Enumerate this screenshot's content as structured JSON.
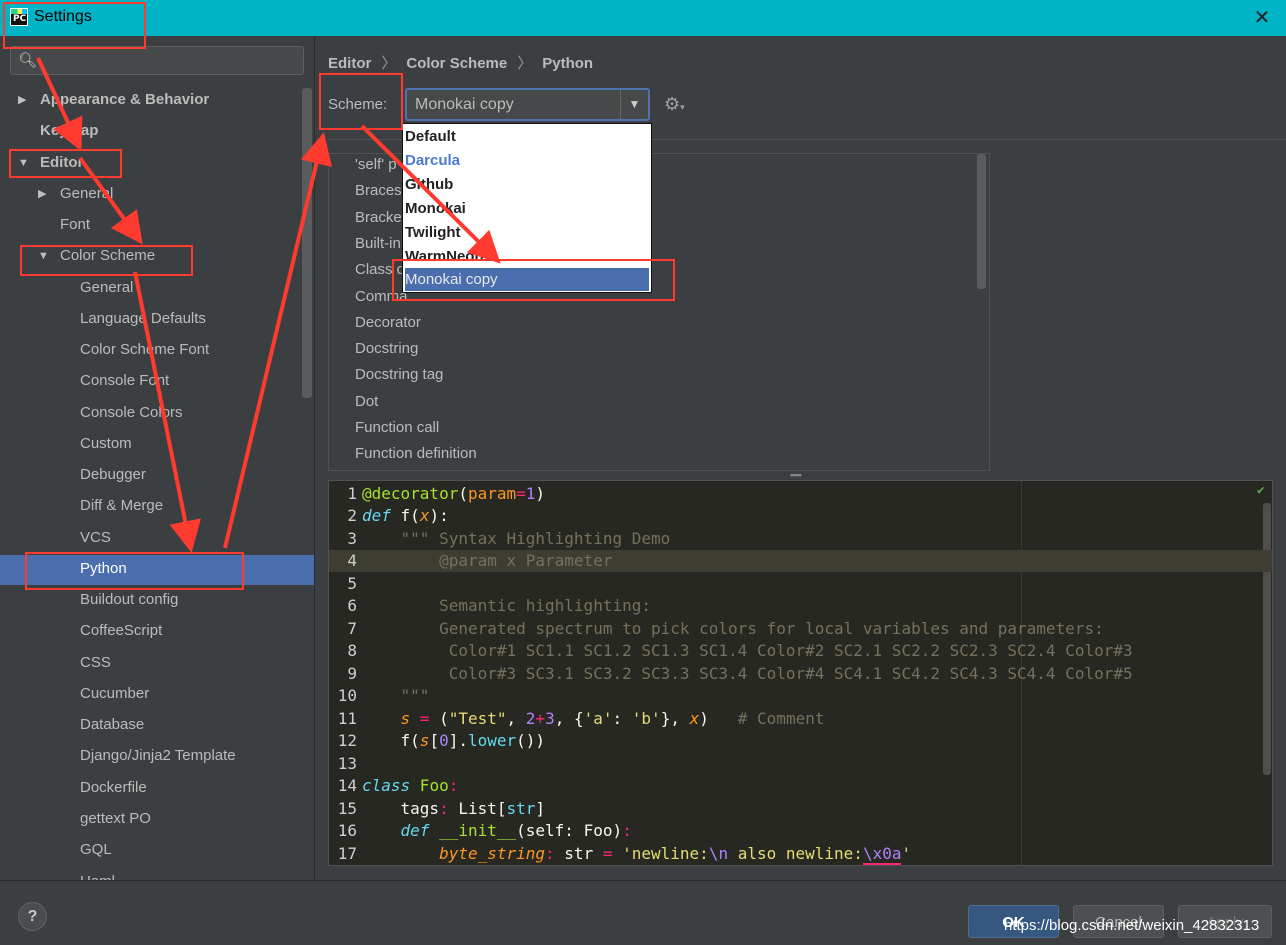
{
  "window": {
    "title": "Settings",
    "close_label": "✕",
    "logo_text": "PC"
  },
  "sidebar": {
    "search_placeholder": "",
    "items": [
      {
        "label": "Appearance & Behavior",
        "arrow": "▶"
      },
      {
        "label": "Keymap"
      },
      {
        "label": "Editor",
        "arrow": "▼"
      },
      {
        "label": "General",
        "arrow": "▶"
      },
      {
        "label": "Font"
      },
      {
        "label": "Color Scheme",
        "arrow": "▼"
      },
      {
        "label": "General"
      },
      {
        "label": "Language Defaults"
      },
      {
        "label": "Color Scheme Font"
      },
      {
        "label": "Console Font"
      },
      {
        "label": "Console Colors"
      },
      {
        "label": "Custom"
      },
      {
        "label": "Debugger"
      },
      {
        "label": "Diff & Merge"
      },
      {
        "label": "VCS"
      },
      {
        "label": "Python"
      },
      {
        "label": "Buildout config"
      },
      {
        "label": "CoffeeScript"
      },
      {
        "label": "CSS"
      },
      {
        "label": "Cucumber"
      },
      {
        "label": "Database"
      },
      {
        "label": "Django/Jinja2 Template"
      },
      {
        "label": "Dockerfile"
      },
      {
        "label": "gettext PO"
      },
      {
        "label": "GQL"
      },
      {
        "label": "Haml"
      }
    ]
  },
  "breadcrumb": [
    "Editor",
    "Color Scheme",
    "Python"
  ],
  "breadcrumb_sep": "〉",
  "scheme": {
    "label": "Scheme:",
    "value": "Monokai copy",
    "options": [
      "Default",
      "Darcula",
      "Github",
      "Monokai",
      "Twilight",
      "WarmNeon",
      "Monokai copy"
    ]
  },
  "elements": [
    "'self' p",
    "Braces",
    "Bracke",
    "Built-in",
    "Class d",
    "Comma",
    "Decorator",
    "Docstring",
    "Docstring tag",
    "Dot",
    "Function call",
    "Function definition"
  ],
  "editor": {
    "line_numbers": [
      "1",
      "2",
      "3",
      "4",
      "5",
      "6",
      "7",
      "8",
      "9",
      "10",
      "11",
      "12",
      "13",
      "14",
      "15",
      "16",
      "17"
    ],
    "current_line": 4,
    "texts": {
      "l1_deco": "@decorator",
      "l1_paren": "(",
      "l1_param": "param",
      "l1_eq": "=",
      "l1_num": "1",
      "l1_close": ")",
      "l2_def": "def",
      "l2_name": " f(",
      "l2_x": "x",
      "l2_end": "):",
      "l3": "    \"\"\" Syntax Highlighting Demo",
      "l4": "        @param x Parameter",
      "l6": "        Semantic highlighting:",
      "l7": "        Generated spectrum to pick colors for local variables and parameters:",
      "l8": "         Color#1 SC1.1 SC1.2 SC1.3 SC1.4 Color#2 SC2.1 SC2.2 SC2.3 SC2.4 Color#3",
      "l9": "         Color#3 SC3.1 SC3.2 SC3.3 SC3.4 Color#4 SC4.1 SC4.2 SC4.3 SC4.4 Color#5",
      "l10": "    \"\"\"",
      "l11_s": "s",
      "l11_eq": " = ",
      "l11_open": "(",
      "l11_str": "\"Test\"",
      "l11_c1": ", ",
      "l11_n1": "2",
      "l11_plus": "+",
      "l11_n2": "3",
      "l11_c2": ", {",
      "l11_a": "'a'",
      "l11_colon": ": ",
      "l11_b": "'b'",
      "l11_c3": "}, ",
      "l11_x": "x",
      "l11_close": ")",
      "l11_cmt": "   # Comment",
      "l12_f": "    f(",
      "l12_s": "s",
      "l12_idx": "[",
      "l12_zero": "0",
      "l12_rest": "].",
      "l12_lower": "lower",
      "l12_end": "())",
      "l14_class": "class",
      "l14_name": " Foo",
      "l14_colon": ":",
      "l15_tags": "    tags",
      "l15_colon": ": ",
      "l15_list": "List",
      "l15_br": "[",
      "l15_str": "str",
      "l15_end": "]",
      "l16_def": "    def",
      "l16_init": " __init__",
      "l16_rest": "(self: Foo)",
      "l16_colon": ":",
      "l17_var": "        byte_string",
      "l17_colon": ": ",
      "l17_type": "str",
      "l17_eq": " = ",
      "l17_str1": "'newline:",
      "l17_esc1": "\\n",
      "l17_str2": " also newline:",
      "l17_esc2": "\\x0a",
      "l17_str3": "'"
    }
  },
  "buttons": {
    "help": "?",
    "ok": "OK",
    "cancel": "Cancel",
    "apply": "Apply"
  },
  "watermark": "https://blog.csdn.net/weixin_42832313",
  "colors": {
    "accent": "#4b6eaf",
    "titlebar": "#00b4c8",
    "annotation": "#ff3b30",
    "editor_bg": "#272822"
  }
}
